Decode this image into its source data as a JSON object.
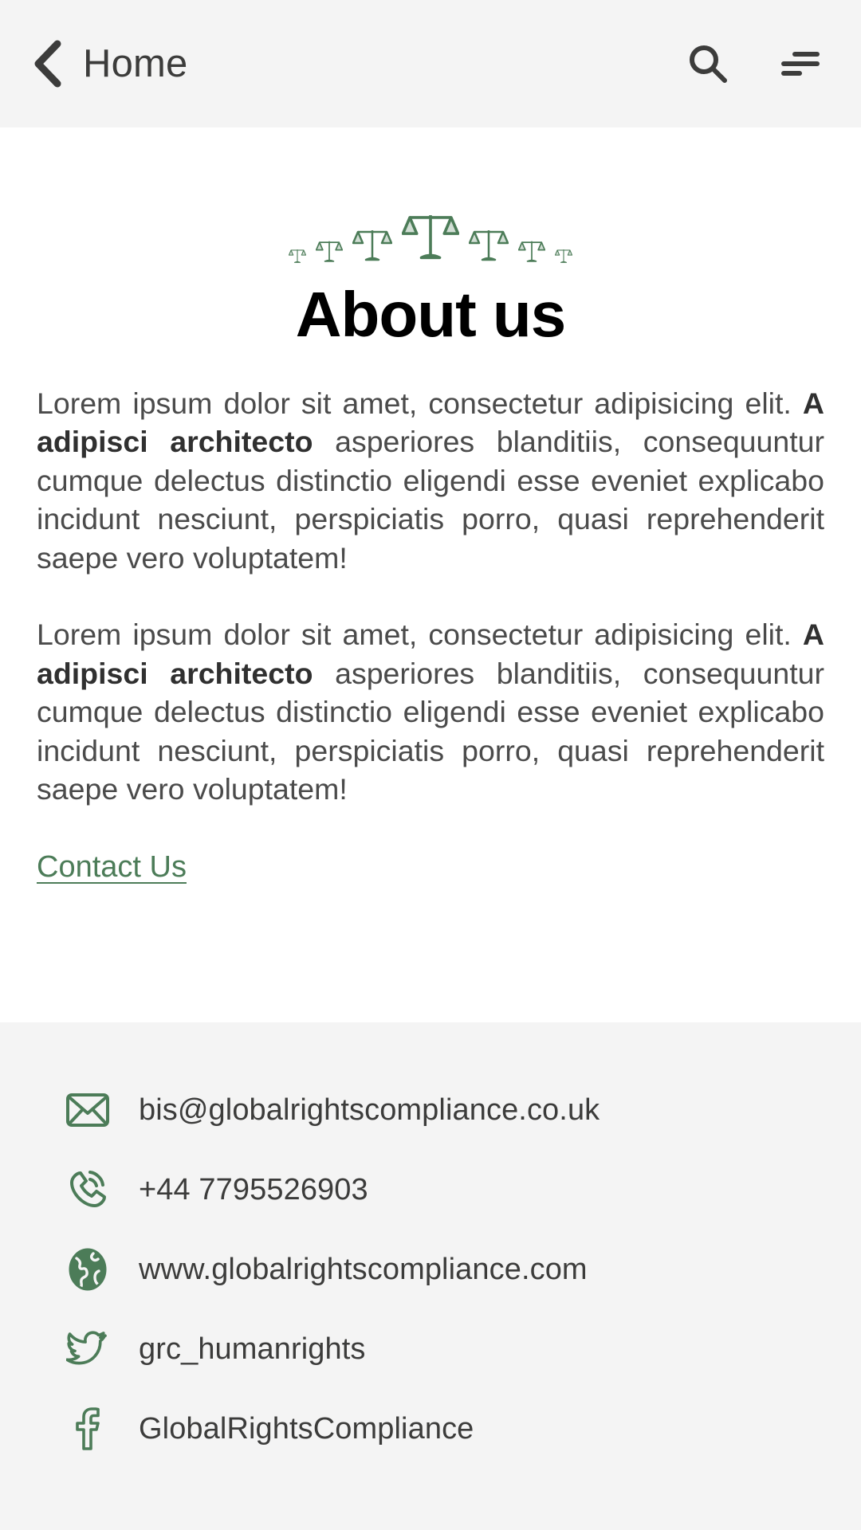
{
  "header": {
    "back_label": "Home",
    "back_icon": "chevron-left-icon",
    "search_icon": "search-icon",
    "menu_icon": "hamburger-menu-icon"
  },
  "hero": {
    "decoration_icon": "scales-of-justice-icon",
    "decoration_count": 7,
    "title": "About us"
  },
  "body": {
    "paragraphs": [
      {
        "lead": "Lorem ipsum dolor sit amet, consectetur adipisicing elit. ",
        "bold": "A adipisci architecto",
        "rest": " asperiores blanditiis, consequuntur cumque delectus distinctio eligendi esse eveniet explicabo incidunt nesciunt, perspiciatis porro, quasi reprehenderit saepe vero voluptatem!"
      },
      {
        "lead": "Lorem ipsum dolor sit amet, consectetur adipisicing elit. ",
        "bold": "A adipisci architecto",
        "rest": " asperiores blanditiis, consequuntur cumque delectus distinctio eligendi esse eveniet explicabo incidunt nesciunt, perspiciatis porro, quasi reprehenderit saepe vero voluptatem!"
      }
    ],
    "contact_link_label": "Contact Us"
  },
  "footer": {
    "contacts": [
      {
        "icon": "email-icon",
        "value": "bis@globalrightscompliance.co.uk"
      },
      {
        "icon": "phone-icon",
        "value": "+44 7795526903"
      },
      {
        "icon": "globe-icon",
        "value": "www.globalrightscompliance.com"
      },
      {
        "icon": "twitter-icon",
        "value": "grc_humanrights"
      },
      {
        "icon": "facebook-icon",
        "value": "GlobalRightsCompliance"
      }
    ]
  },
  "colors": {
    "accent_green": "#4c7c58",
    "header_bg": "#f4f4f4",
    "footer_bg": "#f4f4f4",
    "body_text": "#4b4b4b",
    "heading": "#000000"
  }
}
